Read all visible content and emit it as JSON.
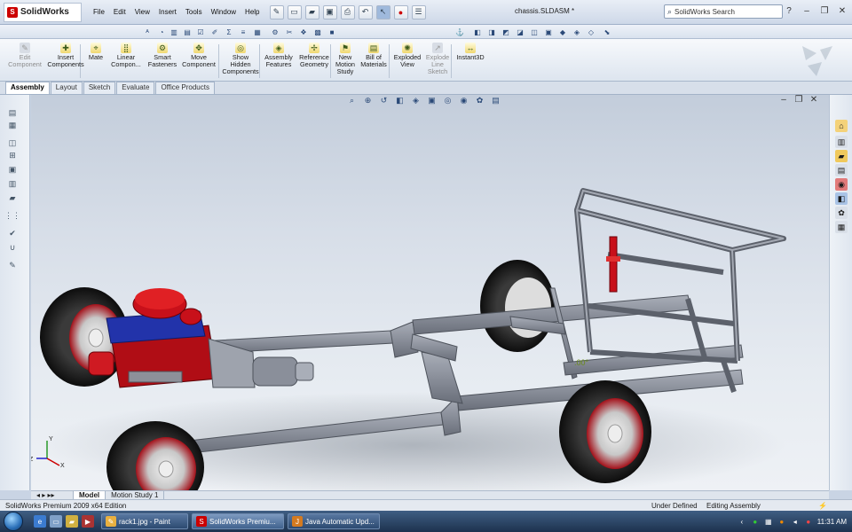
{
  "app": {
    "brand": "SolidWorks",
    "document_title": "chassis.SLDASM *",
    "search_placeholder": "SolidWorks Search"
  },
  "menu": [
    "File",
    "Edit",
    "View",
    "Insert",
    "Tools",
    "Window",
    "Help"
  ],
  "command_manager": [
    {
      "label": "Edit\nComponent",
      "icon": "edit-component-icon",
      "enabled": false
    },
    {
      "label": "Insert\nComponents",
      "icon": "insert-components-icon",
      "enabled": true
    },
    {
      "label": "Mate",
      "icon": "mate-icon",
      "enabled": true
    },
    {
      "label": "Linear\nCompon...",
      "icon": "linear-pattern-icon",
      "enabled": true
    },
    {
      "label": "Smart\nFasteners",
      "icon": "smart-fasteners-icon",
      "enabled": true
    },
    {
      "label": "Move\nComponent",
      "icon": "move-component-icon",
      "enabled": true
    },
    {
      "label": "Show\nHidden\nComponents",
      "icon": "show-hidden-icon",
      "enabled": true
    },
    {
      "label": "Assembly\nFeatures",
      "icon": "assembly-features-icon",
      "enabled": true
    },
    {
      "label": "Reference\nGeometry",
      "icon": "reference-geometry-icon",
      "enabled": true
    },
    {
      "label": "New\nMotion\nStudy",
      "icon": "motion-study-icon",
      "enabled": true
    },
    {
      "label": "Bill of\nMaterials",
      "icon": "bom-icon",
      "enabled": true
    },
    {
      "label": "Exploded\nView",
      "icon": "exploded-view-icon",
      "enabled": true
    },
    {
      "label": "Explode\nLine\nSketch",
      "icon": "explode-line-icon",
      "enabled": false
    },
    {
      "label": "Instant3D",
      "icon": "instant3d-icon",
      "enabled": true
    }
  ],
  "tabs": [
    "Assembly",
    "Layout",
    "Sketch",
    "Evaluate",
    "Office Products"
  ],
  "active_tab": "Assembly",
  "bottom_tabs": [
    "Model",
    "Motion Study 1"
  ],
  "viewport": {
    "angle_label": ".00°",
    "triad_x": "X",
    "triad_y": "Y",
    "triad_z": "Z"
  },
  "status": {
    "edition": "SolidWorks Premium 2009 x64 Edition",
    "definition": "Under Defined",
    "mode": "Editing Assembly"
  },
  "taskbar": {
    "buttons": [
      {
        "label": "rack1.jpg - Paint",
        "icon": "paint-icon"
      },
      {
        "label": "SolidWorks Premiu...",
        "icon": "solidworks-icon"
      },
      {
        "label": "Java Automatic Upd...",
        "icon": "java-icon"
      }
    ],
    "time": "11:31 AM"
  },
  "colors": {
    "frame": "#8a8f9a",
    "engine_red": "#c8101a",
    "engine_blue": "#2233aa",
    "tire": "#1a1a1a",
    "rim_red": "#b3121b"
  }
}
